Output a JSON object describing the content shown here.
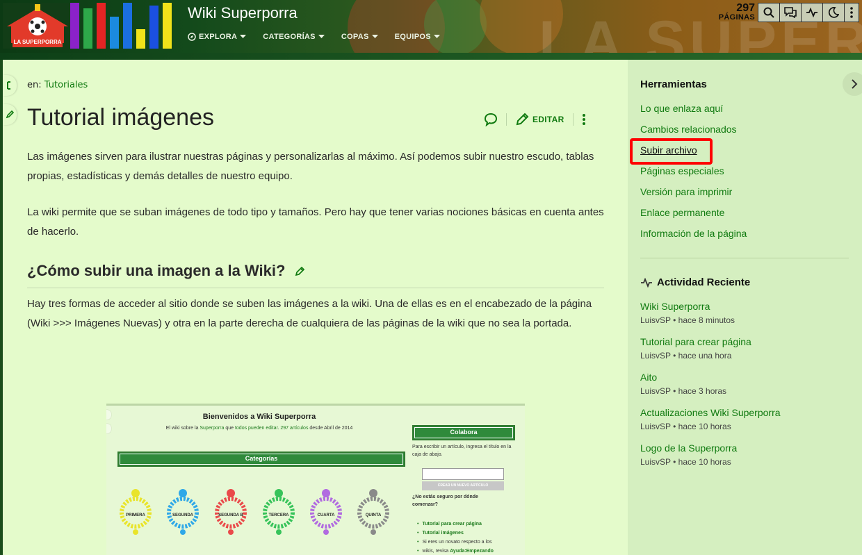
{
  "header": {
    "site_title": "Wiki Superporra",
    "logo_text": "LA SUPERPORRA",
    "banner_word": "LA SUPERPORRA",
    "nav": [
      {
        "label": "EXPLORA"
      },
      {
        "label": "CATEGORÍAS"
      },
      {
        "label": "COPAS"
      },
      {
        "label": "EQUIPOS"
      }
    ],
    "pages_count": "297",
    "pages_label": "PÁGINAS",
    "tool_icons": [
      "search-icon",
      "discussions-icon",
      "activity-icon",
      "dark-mode-icon",
      "more-icon"
    ]
  },
  "page": {
    "breadcrumb_prefix": "en:",
    "breadcrumb_link": "Tutoriales",
    "title": "Tutorial imágenes",
    "edit_label": "EDITAR",
    "para1": "Las imágenes sirven para ilustrar nuestras páginas y personalizarlas al máximo. Así podemos subir nuestro escudo, tablas propias, estadísticas y demás detalles de nuestro equipo.",
    "para2": "La wiki permite que se suban imágenes de todo tipo y tamaños. Pero hay que tener varias nociones básicas en cuenta antes de hacerlo.",
    "heading": "¿Cómo subir una imagen a la Wiki?",
    "para3": "Hay tres formas de acceder al sitio donde se suben las imágenes a la wiki. Una de ellas es en el encabezado de la página (Wiki >>> Imágenes Nuevas) y otra en la parte derecha de cualquiera de las páginas de la wiki que no sea la portada."
  },
  "screenshot": {
    "title": "Bienvenidos a Wiki Superporra",
    "sub_a": "El wiki sobre la ",
    "sub_b": "Superporra",
    "sub_c": " que ",
    "sub_d": "todos pueden editar",
    "sub_e": ". ",
    "sub_f": "297 artículos",
    "sub_g": " desde Abril de 2014",
    "categories_label": "Categorías",
    "collaborate_label": "Colabora",
    "collab_text": "Para escribir un artículo, ingresa el título en la caja de abajo.",
    "create_button": "CREAR UN NUEVO ARTÍCULO",
    "unsure_text": "¿No estás seguro por dónde comenzar?",
    "badges": [
      {
        "label": "PRIMERA",
        "color": "#e9e42a"
      },
      {
        "label": "SEGUNDA",
        "color": "#2fa8e8"
      },
      {
        "label": "SEGUNDA B",
        "color": "#ea4a4a"
      },
      {
        "label": "TERCERA",
        "color": "#37c35a"
      },
      {
        "label": "CUARTA",
        "color": "#b16be0"
      },
      {
        "label": "QUINTA",
        "color": "#8a8a8a"
      }
    ],
    "list": [
      {
        "text": "Tutorial para crear página"
      },
      {
        "text": "Tutorial imágenes"
      },
      {
        "text": "Si eres un novato respecto a los"
      },
      {
        "text_a": "wikis, revisa ",
        "text_b": "Ayuda:Empezando"
      }
    ]
  },
  "sidebar": {
    "tools_heading": "Herramientas",
    "tools": [
      {
        "label": "Lo que enlaza aquí"
      },
      {
        "label": "Cambios relacionados"
      },
      {
        "label": "Subir archivo"
      },
      {
        "label": "Páginas especiales"
      },
      {
        "label": "Versión para imprimir"
      },
      {
        "label": "Enlace permanente"
      },
      {
        "label": "Información de la página"
      }
    ],
    "activity_heading": "Actividad Reciente",
    "activity": [
      {
        "title": "Wiki Superporra",
        "meta": "LuisvSP • hace 8 minutos"
      },
      {
        "title": "Tutorial para crear página",
        "meta": "LuisvSP • hace una hora"
      },
      {
        "title": "Aito",
        "meta": "LuisvSP • hace 3 horas"
      },
      {
        "title": "Actualizaciones Wiki Superporra",
        "meta": "LuisvSP • hace 10 horas"
      },
      {
        "title": "Logo de la Superporra",
        "meta": "LuisvSP • hace 10 horas"
      }
    ]
  },
  "colors": {
    "link": "#107a10",
    "content_bg": "#e4fbcb",
    "sidebar_bg": "#d5efc0",
    "highlight": "#ff0000"
  }
}
